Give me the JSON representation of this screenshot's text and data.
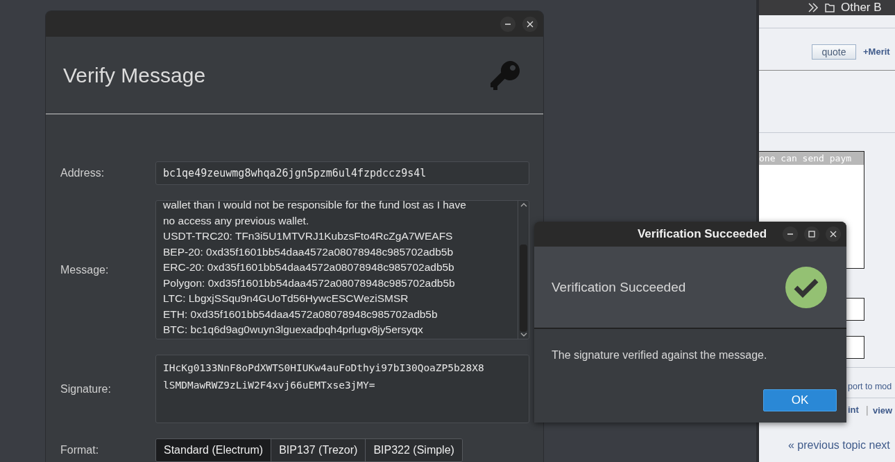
{
  "browser": {
    "toolbar_text": "Other B",
    "quote_button": "quote",
    "merit_link": "+Merit",
    "code_text": "one can send paym",
    "report_link": "port to mod",
    "print_link": "int",
    "separator": "|",
    "view_link": "view",
    "topic_nav": "« previous topic next"
  },
  "verify_window": {
    "title": "Verify Message",
    "fields": [
      {
        "kind": "line",
        "label": "Address:",
        "value": "bc1qe49zeuwmg8whqa26jgn5pzm6ul4fzpdccz9s4l"
      },
      {
        "kind": "text",
        "label": "Message:",
        "lines": [
          "wallet than I would not be responsible for the fund lost as I have",
          "no access any previous wallet.",
          "USDT-TRC20: TFn3i5U1MTVRJ1KubzsFto4RcZgA7WEAFS",
          "BEP-20: 0xd35f1601bb54daa4572a08078948c985702adb5b",
          "ERC-20: 0xd35f1601bb54daa4572a08078948c985702adb5b",
          "Polygon: 0xd35f1601bb54daa4572a08078948c985702adb5b",
          "LTC: LbgxjSSqu9n4GUoTd56HywcESCWeziSMSR",
          "ETH: 0xd35f1601bb54daa4572a08078948c985702adb5b",
          "BTC: bc1q6d9ag0wuyn3lguexadpqh4prlugv8jy5ersyqx"
        ]
      },
      {
        "kind": "mono",
        "label": "Signature:",
        "lines": [
          "IHcKg0133NnF8oPdXWTS0HIUKw4auFoDthyi97bI30QoaZP5b28X8",
          "lSMDMawRWZ9zLiW2F4xvj66uEMTxse3jMY="
        ]
      }
    ],
    "format": {
      "label": "Format:",
      "options": [
        {
          "label": "Standard (Electrum)",
          "selected": true
        },
        {
          "label": "BIP137 (Trezor)",
          "selected": false
        },
        {
          "label": "BIP322 (Simple)",
          "selected": false
        }
      ]
    }
  },
  "dialog": {
    "title": "Verification Succeeded",
    "heading": "Verification Succeeded",
    "message": "The signature verified against the message.",
    "ok_button": "OK"
  }
}
